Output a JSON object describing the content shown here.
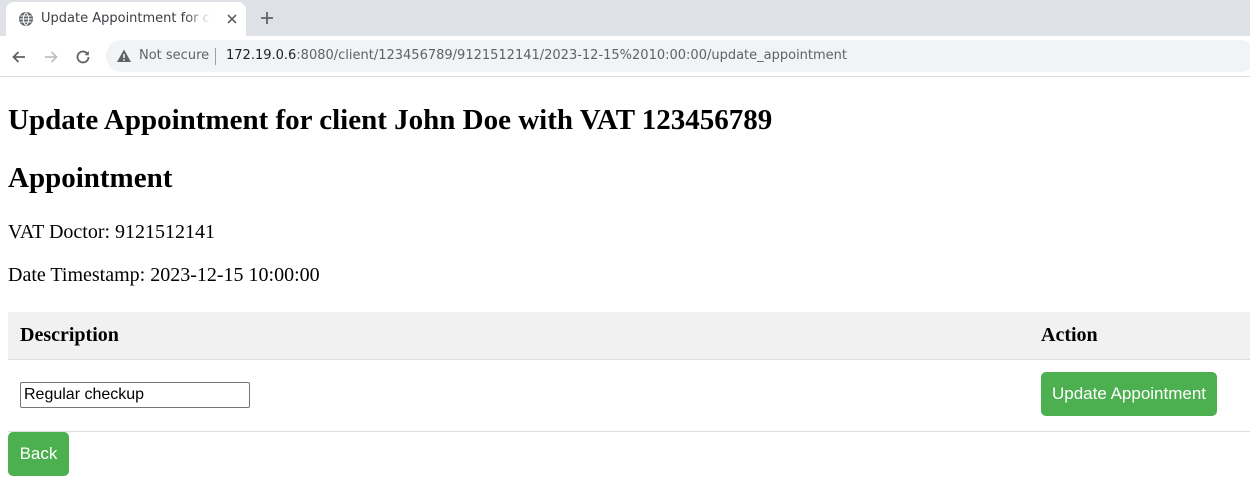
{
  "browser": {
    "tab_title": "Update Appointment for client John Doe",
    "security_label": "Not secure",
    "url_host": "172.19.0.6",
    "url_rest": ":8080/client/123456789/9121512141/2023-12-15%2010:00:00/update_appointment"
  },
  "page": {
    "title": "Update Appointment for client John Doe with VAT 123456789",
    "section_title": "Appointment",
    "vat_doctor_label": "VAT Doctor: 9121512141",
    "date_timestamp_label": "Date Timestamp: 2023-12-15 10:00:00"
  },
  "table": {
    "headers": [
      "Description",
      "Action"
    ],
    "row": {
      "description_value": "Regular checkup",
      "action_label": "Update Appointment"
    }
  },
  "back_label": "Back",
  "colors": {
    "button": "#4caf50",
    "table_header_bg": "#f1f1f1"
  }
}
